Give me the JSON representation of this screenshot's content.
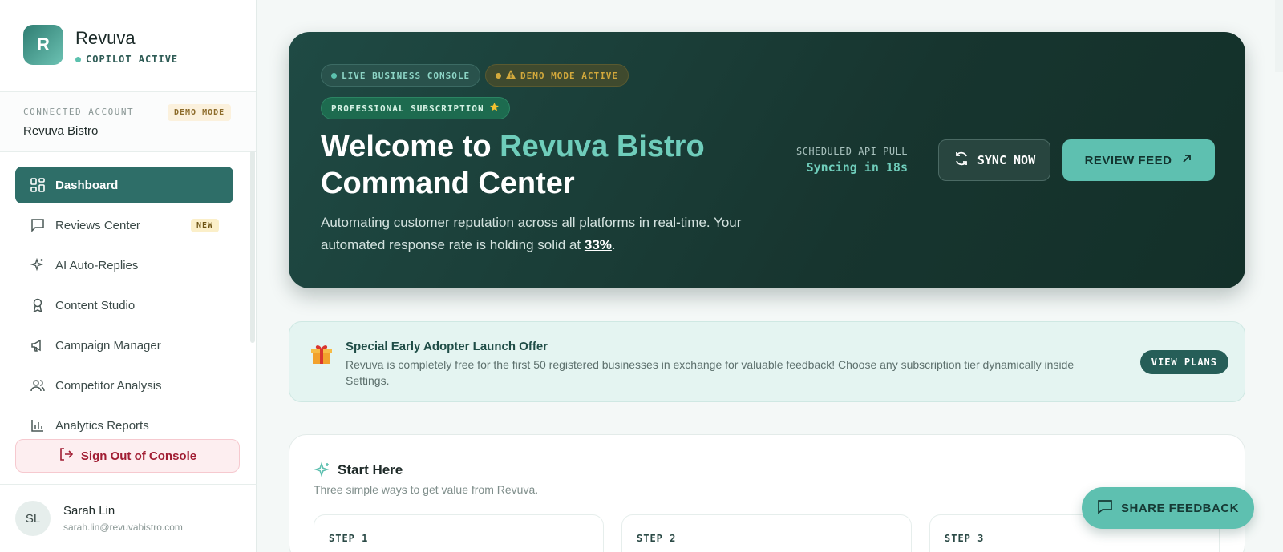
{
  "brand": {
    "logo_letter": "R",
    "name": "Revuva",
    "status": "COPILOT ACTIVE"
  },
  "account": {
    "label": "CONNECTED ACCOUNT",
    "name": "Revuva Bistro",
    "mode": "DEMO MODE"
  },
  "nav": [
    {
      "label": "Dashboard",
      "icon": "dashboard-grid-icon",
      "active": true
    },
    {
      "label": "Reviews Center",
      "icon": "message-square-icon",
      "badge": "NEW"
    },
    {
      "label": "AI Auto-Replies",
      "icon": "sparkles-icon"
    },
    {
      "label": "Content Studio",
      "icon": "award-ribbon-icon"
    },
    {
      "label": "Campaign Manager",
      "icon": "megaphone-icon"
    },
    {
      "label": "Competitor Analysis",
      "icon": "users-icon"
    },
    {
      "label": "Analytics Reports",
      "icon": "bar-chart-icon"
    }
  ],
  "signout": {
    "label": "Sign Out of Console"
  },
  "user": {
    "initials": "SL",
    "name": "Sarah Lin",
    "email": "sarah.lin@revuvabistro.com"
  },
  "hero": {
    "chip_live": "LIVE BUSINESS CONSOLE",
    "chip_demo": "DEMO MODE ACTIVE",
    "chip_pro": "PROFESSIONAL SUBSCRIPTION",
    "title_prefix": "Welcome to ",
    "title_accent": "Revuva Bistro",
    "title_suffix": "Command Center",
    "desc_prefix": "Automating customer reputation across all platforms in real-time. Your automated response rate is holding solid at ",
    "desc_rate": "33%",
    "desc_suffix": ".",
    "sched_label": "SCHEDULED API PULL",
    "sched_value": "Syncing in 18s",
    "sync_label": "SYNC NOW",
    "review_label": "REVIEW FEED"
  },
  "offer": {
    "title": "Special Early Adopter Launch Offer",
    "text": "Revuva is completely free for the first 50 registered businesses in exchange for valuable feedback! Choose any subscription tier dynamically inside Settings.",
    "button": "VIEW PLANS"
  },
  "start": {
    "title": "Start Here",
    "subtitle": "Three simple ways to get value from Revuva.",
    "steps": [
      "STEP 1",
      "STEP 2",
      "STEP 3"
    ]
  },
  "feedback": {
    "label": "SHARE FEEDBACK"
  },
  "colors": {
    "primary": "#2e6e68",
    "accent": "#5ec0b0",
    "hero_bg": "#17352f",
    "danger": "#a11d33"
  }
}
